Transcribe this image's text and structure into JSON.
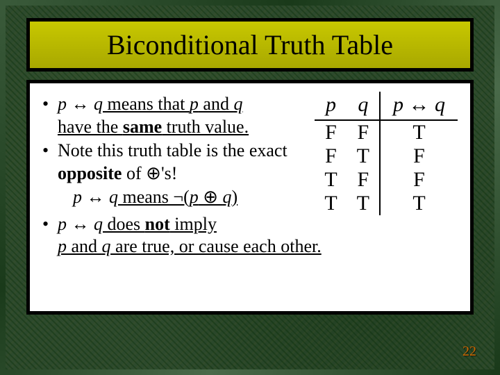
{
  "title": "Biconditional Truth Table",
  "bullets": {
    "b1_pre": "p",
    "b1_sym": " ↔ ",
    "b1_mid": "q",
    "b1_means": " means that ",
    "b1_p2": "p",
    "b1_and": " and ",
    "b1_q2": "q",
    "b1_line2a": "have the ",
    "b1_same": "same",
    "b1_line2b": " truth value.",
    "b2_a": "Note this truth table is the exact ",
    "b2_opp": "opposite",
    "b2_b": " of ",
    "b2_xor": "⊕",
    "b2_c": "'s!",
    "sub_p": "p",
    "sub_sym": " ↔ ",
    "sub_q": "q",
    "sub_means": " means ¬(",
    "sub_p2": "p",
    "sub_xor": " ⊕ ",
    "sub_q2": "q",
    "sub_close": ")",
    "b3_p": "p",
    "b3_sym": " ↔ ",
    "b3_q": "q",
    "b3_a": " does ",
    "b3_not": "not",
    "b3_b": " imply ",
    "b3_line2a": "p",
    "b3_and": " and ",
    "b3_line2b": "q",
    "b3_tail": " are true, or cause each other."
  },
  "chart_data": {
    "type": "table",
    "title": "Biconditional Truth Table",
    "columns": [
      "p",
      "q",
      "p ↔ q"
    ],
    "rows": [
      [
        "F",
        "F",
        "T"
      ],
      [
        "F",
        "T",
        "F"
      ],
      [
        "T",
        "F",
        "F"
      ],
      [
        "T",
        "T",
        "T"
      ]
    ]
  },
  "page_number": "22"
}
